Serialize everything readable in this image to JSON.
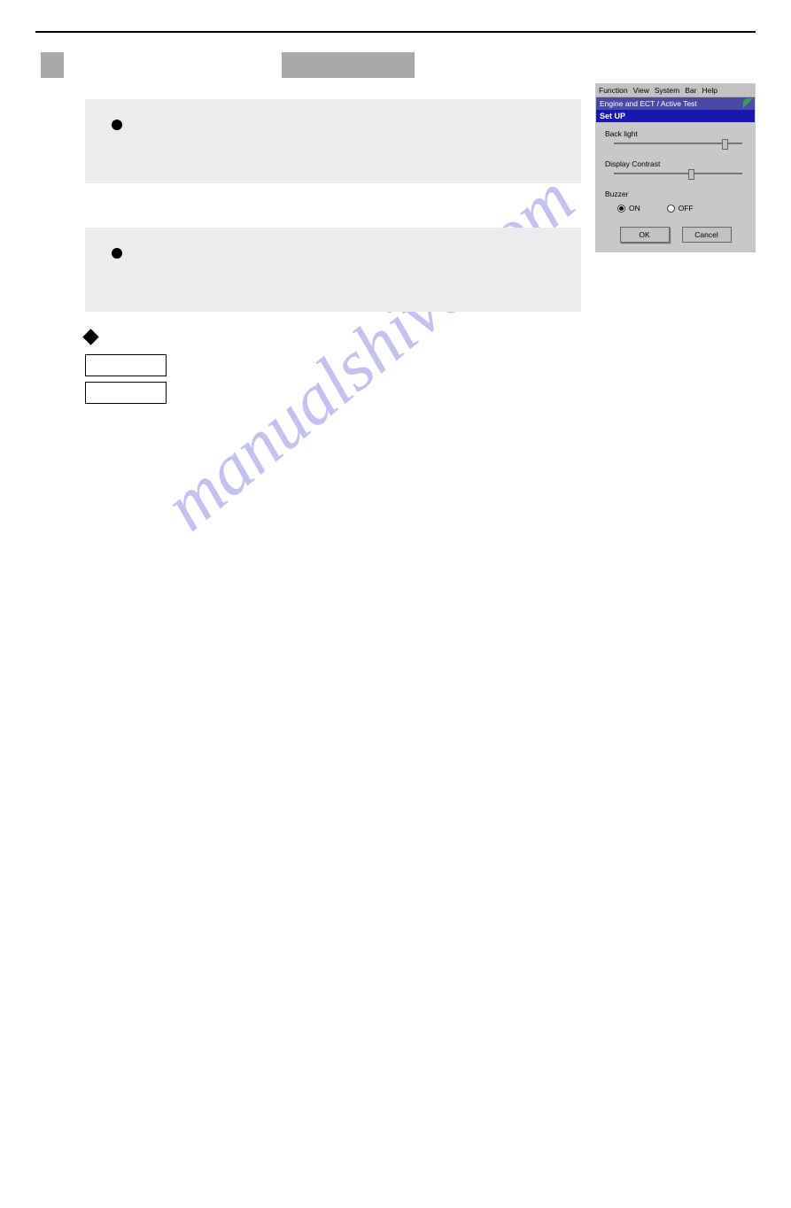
{
  "section": {
    "square": "",
    "label_box": ""
  },
  "panels": {
    "panel1": "",
    "panel2": ""
  },
  "outlined_buttons": [
    "",
    ""
  ],
  "watermark": "manualshive.com",
  "screenshot": {
    "menubar": [
      "Function",
      "View",
      "System",
      "Bar",
      "Help"
    ],
    "crumb": "Engine and ECT / Active Test",
    "subhead": "Set UP",
    "backlight_label": "Back light",
    "backlight_pos_pct": 84,
    "contrast_label": "Display Contrast",
    "contrast_pos_pct": 58,
    "buzzer_label": "Buzzer",
    "radio_on": "ON",
    "radio_off": "OFF",
    "buzzer_selected": "ON",
    "ok": "OK",
    "cancel": "Cancel"
  }
}
